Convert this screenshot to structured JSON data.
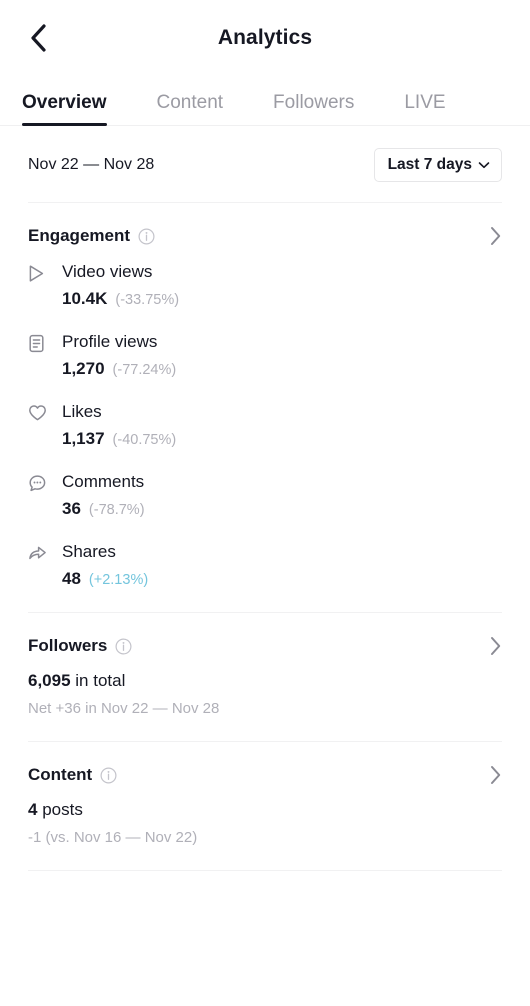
{
  "header": {
    "title": "Analytics",
    "back_icon": "chevron-left-icon"
  },
  "tabs": [
    {
      "label": "Overview",
      "active": true
    },
    {
      "label": "Content",
      "active": false
    },
    {
      "label": "Followers",
      "active": false
    },
    {
      "label": "LIVE",
      "active": false
    }
  ],
  "date_range": {
    "label": "Nov 22 — Nov 28",
    "selector_label": "Last 7 days",
    "selector_icon": "chevron-down-icon"
  },
  "engagement": {
    "title": "Engagement",
    "info_icon": "info-icon",
    "chevron_icon": "chevron-right-icon",
    "metrics": [
      {
        "icon": "play-icon",
        "name": "Video views",
        "value": "10.4K",
        "delta": "(-33.75%)",
        "positive": false
      },
      {
        "icon": "document-icon",
        "name": "Profile views",
        "value": "1,270",
        "delta": "(-77.24%)",
        "positive": false
      },
      {
        "icon": "heart-icon",
        "name": "Likes",
        "value": "1,137",
        "delta": "(-40.75%)",
        "positive": false
      },
      {
        "icon": "comment-icon",
        "name": "Comments",
        "value": "36",
        "delta": "(-78.7%)",
        "positive": false
      },
      {
        "icon": "share-icon",
        "name": "Shares",
        "value": "48",
        "delta": "(+2.13%)",
        "positive": true
      }
    ]
  },
  "followers": {
    "title": "Followers",
    "info_icon": "info-icon",
    "chevron_icon": "chevron-right-icon",
    "value": "6,095",
    "value_suffix": " in total",
    "sub": "Net +36 in Nov 22 — Nov 28"
  },
  "content": {
    "title": "Content",
    "info_icon": "info-icon",
    "chevron_icon": "chevron-right-icon",
    "value": "4",
    "value_suffix": " posts",
    "sub": "-1 (vs. Nov 16 — Nov 22)"
  },
  "colors": {
    "text_primary": "#161823",
    "text_muted": "#b0b0b8",
    "positive": "#74c5dd",
    "divider": "#f1f1f2"
  }
}
